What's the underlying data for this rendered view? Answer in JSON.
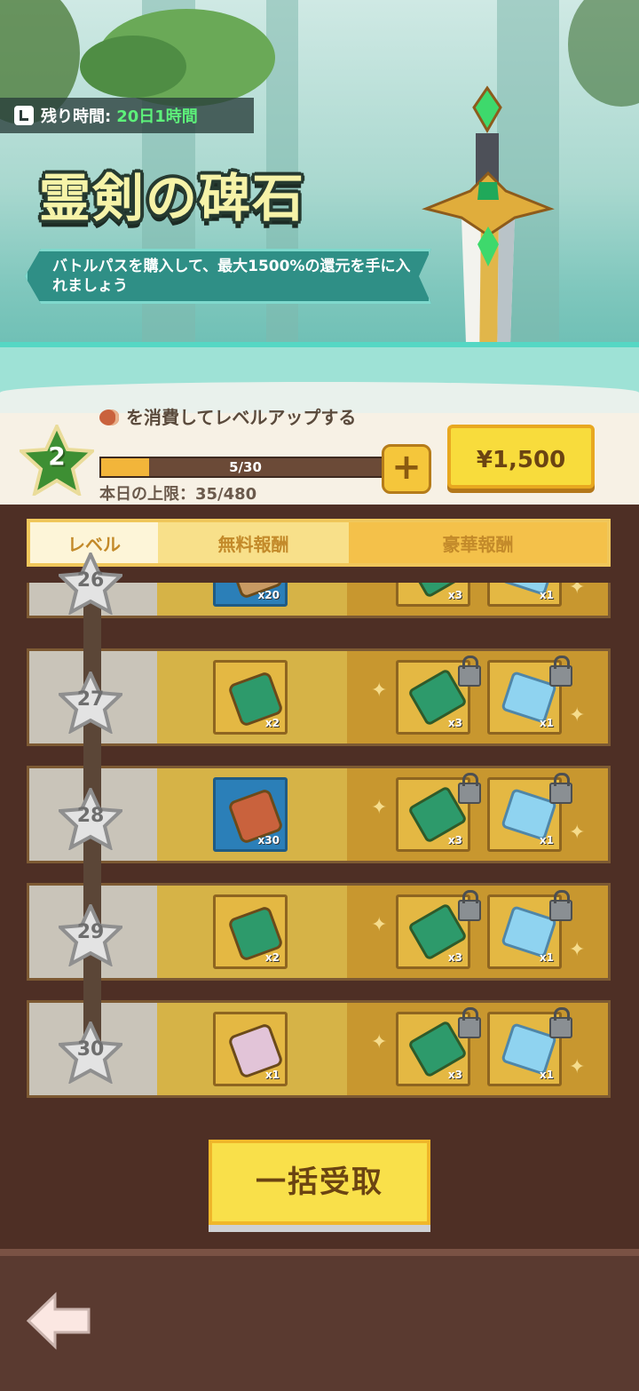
{
  "banner": {
    "timer_label": "残り時間:",
    "timer_value": "20日1時間",
    "title": "霊剣の碑石",
    "subtitle": "バトルパスを購入して、最大1500%の還元を手に入れましょう"
  },
  "status": {
    "level": "2",
    "consume_text": "を消費してレベルアップする",
    "progress_text": "5/30",
    "progress_fraction": 0.1667,
    "daily_limit": "本日の上限：35/480",
    "price": "¥1,500"
  },
  "tabs": {
    "level": "レベル",
    "free": "無料報酬",
    "premium": "豪華報酬"
  },
  "rows": [
    {
      "level": "26",
      "free": {
        "icon": "exp-icon",
        "count": "x20"
      },
      "premium": [
        {
          "icon": "green-ticket-icon",
          "count": "x3"
        },
        {
          "icon": "blue-envelope-icon",
          "count": "x1"
        }
      ]
    },
    {
      "level": "27",
      "free": {
        "icon": "green-ticket-icon",
        "count": "x2"
      },
      "premium": [
        {
          "icon": "green-ticket-icon",
          "count": "x3"
        },
        {
          "icon": "blue-envelope-icon",
          "count": "x1"
        }
      ]
    },
    {
      "level": "28",
      "free": {
        "icon": "meat-icon",
        "count": "x30"
      },
      "premium": [
        {
          "icon": "green-ticket-icon",
          "count": "x3"
        },
        {
          "icon": "blue-envelope-icon",
          "count": "x1"
        }
      ]
    },
    {
      "level": "29",
      "free": {
        "icon": "green-ticket-icon",
        "count": "x2"
      },
      "premium": [
        {
          "icon": "green-ticket-icon",
          "count": "x3"
        },
        {
          "icon": "blue-envelope-icon",
          "count": "x1"
        }
      ]
    },
    {
      "level": "30",
      "free": {
        "icon": "dice-chest-icon",
        "count": "x1"
      },
      "premium": [
        {
          "icon": "green-ticket-icon",
          "count": "x3"
        },
        {
          "icon": "blue-envelope-icon",
          "count": "x1"
        }
      ]
    }
  ],
  "claim_all": "一括受取",
  "colors": {
    "accent_yellow": "#f9e04a",
    "green_timer": "#5df17a",
    "level_badge": "#3d8f33"
  }
}
